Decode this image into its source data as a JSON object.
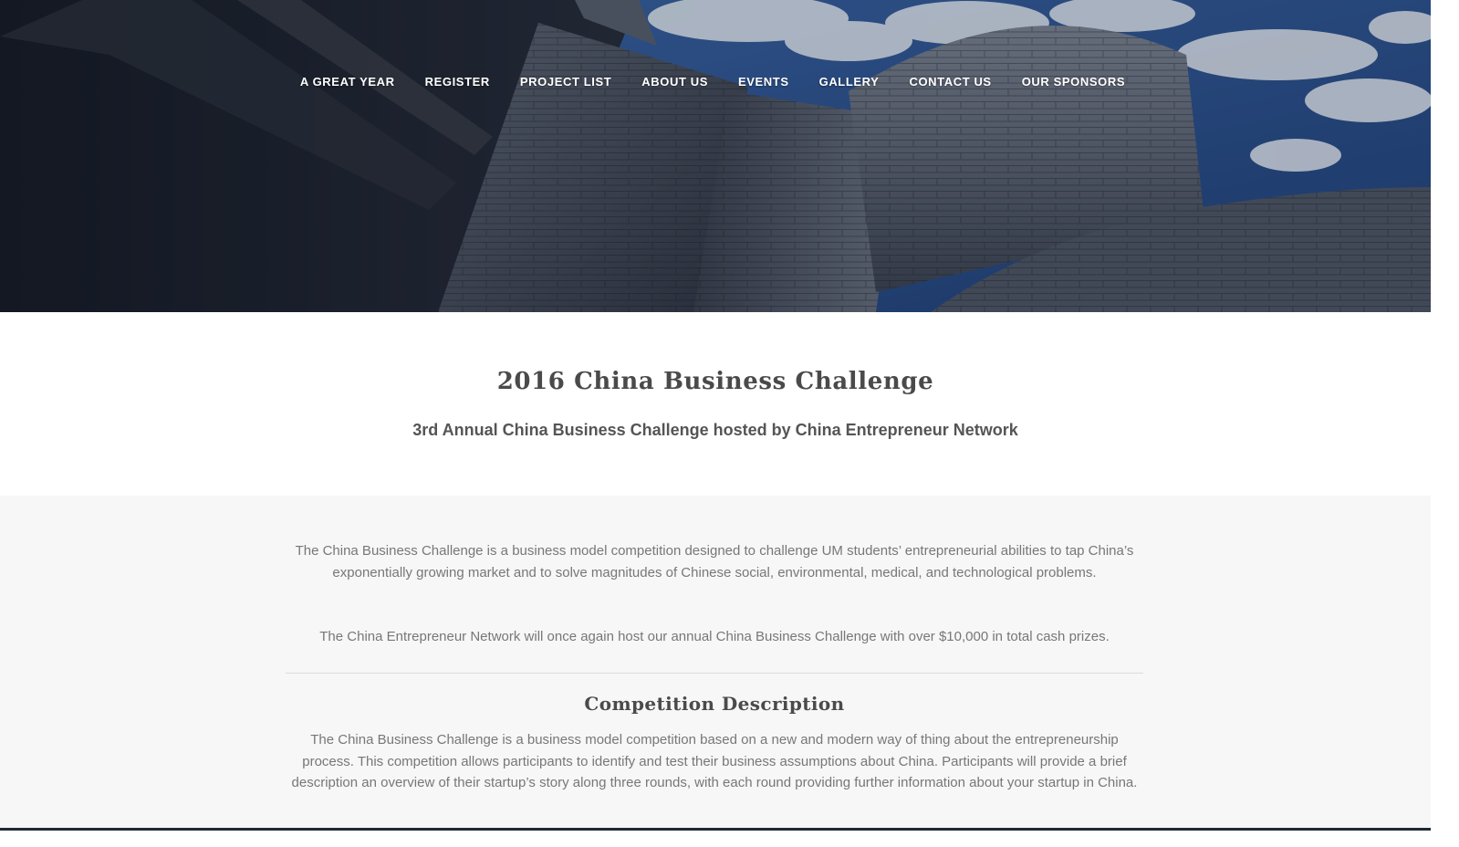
{
  "nav": {
    "items": [
      {
        "label": "A GREAT YEAR"
      },
      {
        "label": "REGISTER"
      },
      {
        "label": "PROJECT LIST"
      },
      {
        "label": "ABOUT US"
      },
      {
        "label": "EVENTS"
      },
      {
        "label": "GALLERY"
      },
      {
        "label": "CONTACT US"
      },
      {
        "label": "OUR SPONSORS"
      }
    ]
  },
  "intro": {
    "title": "2016 China Business Challenge",
    "subtitle": "3rd Annual China Business Challenge hosted by China Entrepreneur Network"
  },
  "content": {
    "paragraph1": "The China Business Challenge is a business model competition designed to challenge UM students’ entrepreneurial abilities to tap China’s exponentially growing market and to solve magnitudes of Chinese social, environmental, medical, and technological problems.",
    "paragraph2": "The China Entrepreneur Network will once again host our annual China Business Challenge with over $10,000 in total cash prizes.",
    "section_title": "Competition Description",
    "paragraph3": "The China Business Challenge is a business model competition based on a new and modern way of thing about the entrepreneurship process. This competition allows participants to identify and test their business assumptions about China. Participants will provide a brief description an overview of their startup’s story along three rounds, with each round providing further information about your startup in China."
  },
  "colors": {
    "hero_dark": "#1b2130",
    "sky": "#2f5a9a",
    "heading": "#4a4a4a",
    "body_text": "#777777",
    "content_bg": "#f7f7f7"
  }
}
